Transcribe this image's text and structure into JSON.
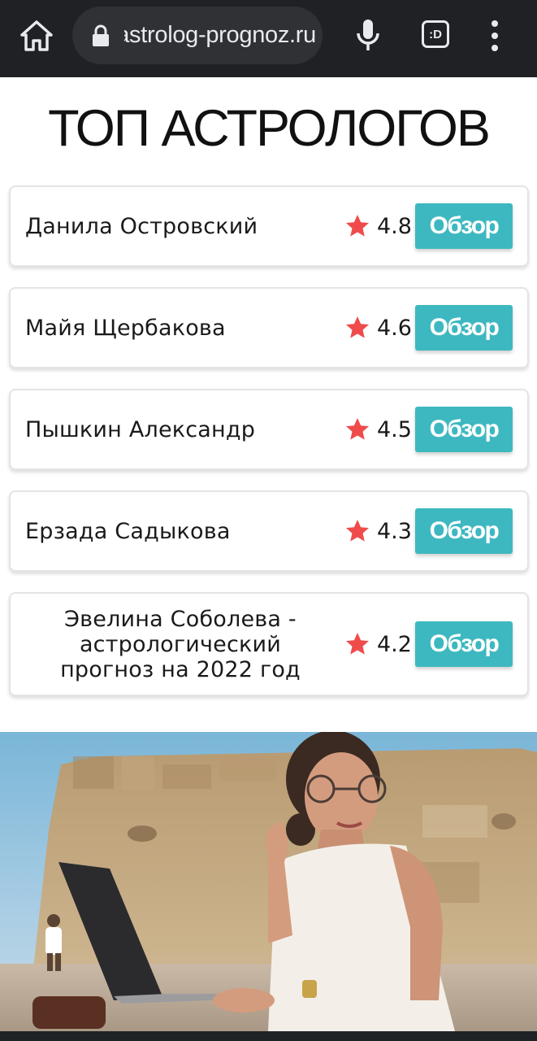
{
  "browser": {
    "url": "astrolog-prognoz.ru",
    "tab_count": ":D"
  },
  "page": {
    "title": "ТОП АСТРОЛОГОВ"
  },
  "astrologers": [
    {
      "name": "Данила Островский",
      "rating": "4.8",
      "button": "Обзор"
    },
    {
      "name": "Майя Щербакова",
      "rating": "4.6",
      "button": "Обзор"
    },
    {
      "name": "Пышкин Александр",
      "rating": "4.5",
      "button": "Обзор"
    },
    {
      "name": "Ерзада Садыкова",
      "rating": "4.3",
      "button": "Обзор"
    },
    {
      "name": "Эвелина Соболева - астрологический прогноз на 2022 год",
      "rating": "4.2",
      "button": "Обзор"
    }
  ],
  "colors": {
    "accent": "#3eb8c0",
    "star": "#f04b4b",
    "browser_bar": "#202124"
  },
  "icons": [
    "home-icon",
    "lock-icon",
    "microphone-icon",
    "more-vert-icon",
    "star-icon"
  ]
}
